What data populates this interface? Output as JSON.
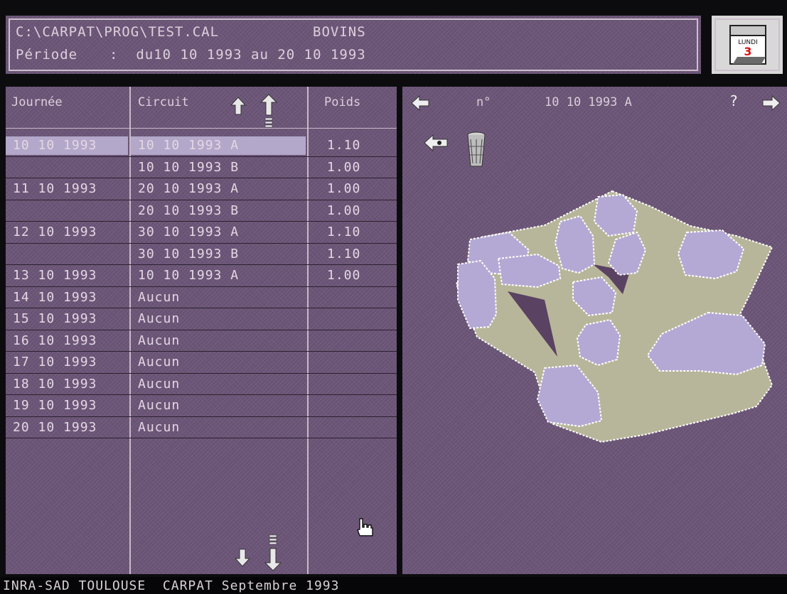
{
  "header": {
    "path": "C:\\CARPAT\\PROG\\TEST.CAL",
    "species": "BOVINS",
    "period_label": "Période",
    "period_value": ":  du10 10 1993 au 20 10 1993"
  },
  "table": {
    "columns": [
      "Journée",
      "Circuit",
      "Poids"
    ],
    "rows": [
      {
        "day": "10 10 1993",
        "circuit": "10 10 1993 A",
        "weight": "1.10",
        "selected": true
      },
      {
        "day": "",
        "circuit": "10 10 1993 B",
        "weight": "1.00"
      },
      {
        "day": "11 10 1993",
        "circuit": "20 10 1993 A",
        "weight": "1.00"
      },
      {
        "day": "",
        "circuit": "20 10 1993 B",
        "weight": "1.00"
      },
      {
        "day": "12 10 1993",
        "circuit": "30 10 1993 A",
        "weight": "1.10"
      },
      {
        "day": "",
        "circuit": "30 10 1993 B",
        "weight": "1.10"
      },
      {
        "day": "13 10 1993",
        "circuit": "10 10 1993 A",
        "weight": "1.00"
      },
      {
        "day": "14 10 1993",
        "circuit": "Aucun",
        "weight": ""
      },
      {
        "day": "15 10 1993",
        "circuit": "Aucun",
        "weight": ""
      },
      {
        "day": "16 10 1993",
        "circuit": "Aucun",
        "weight": ""
      },
      {
        "day": "17 10 1993",
        "circuit": "Aucun",
        "weight": ""
      },
      {
        "day": "18 10 1993",
        "circuit": "Aucun",
        "weight": ""
      },
      {
        "day": "19 10 1993",
        "circuit": "Aucun",
        "weight": ""
      },
      {
        "day": "20 10 1993",
        "circuit": "Aucun",
        "weight": ""
      }
    ]
  },
  "viewer": {
    "number_label": "n°",
    "circuit_label": "10 10 1993 A",
    "help": "?"
  },
  "calendar": {
    "weekday": "LUNDI",
    "day": "3"
  },
  "status": {
    "text": "INRA-SAD TOULOUSE  CARPAT Septembre 1993"
  },
  "colors": {
    "panel": "#6b5577",
    "selection": "#b3a8c9",
    "field": "#b8b69a",
    "paddock": "#b4a9d4"
  }
}
